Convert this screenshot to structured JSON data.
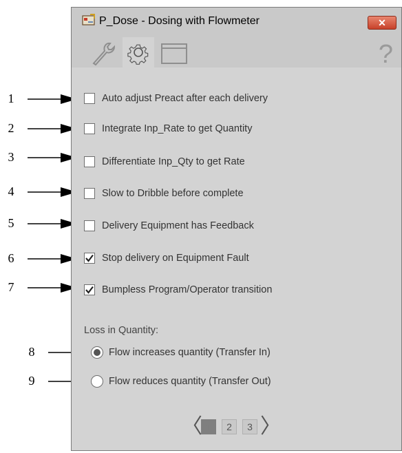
{
  "window": {
    "title": "P_Dose - Dosing with Flowmeter",
    "close_label": "✕",
    "help_label": "?"
  },
  "tabs": [
    {
      "name": "maintenance",
      "icon": "wrench-icon"
    },
    {
      "name": "configuration",
      "icon": "gear-icon",
      "active": true
    },
    {
      "name": "faceplate",
      "icon": "window-icon"
    }
  ],
  "callouts": [
    "1",
    "2",
    "3",
    "4",
    "5",
    "6",
    "7",
    "8",
    "9"
  ],
  "options": [
    {
      "label": "Auto adjust Preact after each delivery",
      "checked": false
    },
    {
      "label": "Integrate Inp_Rate to get Quantity",
      "checked": false
    },
    {
      "label": "Differentiate Inp_Qty to get Rate",
      "checked": false
    },
    {
      "label": "Slow to Dribble before complete",
      "checked": false
    },
    {
      "label": "Delivery Equipment has Feedback",
      "checked": false
    },
    {
      "label": "Stop delivery on Equipment Fault",
      "checked": true
    },
    {
      "label": "Bumpless Program/Operator transition",
      "checked": true
    }
  ],
  "loss_section": {
    "label": "Loss in Quantity:",
    "options": [
      {
        "label": "Flow increases quantity (Transfer In)",
        "selected": true
      },
      {
        "label": "Flow reduces quantity (Transfer Out)",
        "selected": false
      }
    ]
  },
  "pager": {
    "pages": [
      "1",
      "2",
      "3"
    ],
    "current": "1",
    "prev": "〈",
    "next": "〉"
  }
}
